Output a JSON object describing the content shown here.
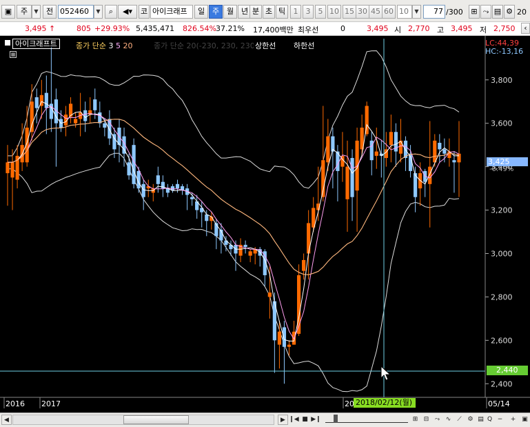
{
  "toolbar": {
    "market": "주",
    "prev": "전",
    "code": "052460",
    "kor": "코",
    "name": "아이크래프",
    "periods": [
      "일",
      "주",
      "월",
      "년"
    ],
    "sub": [
      "분",
      "초",
      "틱"
    ],
    "intervals": [
      "1",
      "3",
      "5",
      "10",
      "15",
      "30",
      "45",
      "60"
    ],
    "count_value": "10",
    "page_value": "77",
    "page_total": "/300",
    "right_edge": "20"
  },
  "quote": {
    "price": "3,495",
    "arrow": "↑",
    "change": "805",
    "change_pct": "+29.93%",
    "volume": "5,435,471",
    "volume_ratio": "826.54%",
    "turnover": "37.21%",
    "amount": "17,400백만",
    "grade": "최우선",
    "grade_value": "0",
    "ask": "3,495",
    "open_label": "시",
    "open": "2,770",
    "high_label": "고",
    "high": "3,495",
    "low_label": "저",
    "low": "2,750"
  },
  "legend": {
    "name": "아이크래프트",
    "ma": "종가 단순",
    "ma_periods": [
      "3",
      "5",
      "20"
    ],
    "env": "종가 단순 20(-230, 230, 230)",
    "upper": "상한선",
    "lower": "하한선"
  },
  "lc": "LC:44,39",
  "hc": "HC:-13,16",
  "price_badge": "3,425",
  "price_change": "-0.49%",
  "cursor_badge": "2,440",
  "cursor_date": "2018/02/12(월)",
  "colors": {
    "up": "#ff6a00",
    "down": "#8ec8ff",
    "cursor_badge": "#66cc33",
    "price_badge": "#87b8ff"
  },
  "chart_data": {
    "type": "candlestick",
    "y_ticks": [
      "3,800",
      "3,600",
      "3,400",
      "3,200",
      "3,000",
      "2,800",
      "2,600",
      "2,400"
    ],
    "x_labels": [
      "2016",
      "2017",
      "20",
      "05/14"
    ],
    "ylim": [
      2350,
      3990
    ],
    "candles": [
      [
        3370,
        3420,
        3220,
        3500
      ],
      [
        3350,
        3420,
        3200,
        3480
      ],
      [
        3340,
        3450,
        3300,
        3500
      ],
      [
        3420,
        3500,
        3380,
        3600
      ],
      [
        3420,
        3580,
        3400,
        3680
      ],
      [
        3560,
        3700,
        3520,
        3780
      ],
      [
        3720,
        3670,
        3600,
        3760
      ],
      [
        3680,
        3730,
        3620,
        3800
      ],
      [
        3740,
        3670,
        3550,
        3820
      ],
      [
        3690,
        3620,
        3560,
        3950
      ],
      [
        3710,
        3600,
        3400,
        3760
      ],
      [
        3620,
        3580,
        3560,
        3660
      ],
      [
        3590,
        3640,
        3540,
        3680
      ],
      [
        3630,
        3690,
        3600,
        3720
      ],
      [
        3600,
        3620,
        3580,
        3650
      ],
      [
        3620,
        3650,
        3540,
        3740
      ],
      [
        3660,
        3610,
        3560,
        3700
      ],
      [
        3640,
        3660,
        3600,
        3720
      ],
      [
        3710,
        3660,
        3620,
        3760
      ],
      [
        3650,
        3600,
        3580,
        3700
      ],
      [
        3600,
        3580,
        3540,
        3620
      ],
      [
        3620,
        3530,
        3500,
        3660
      ],
      [
        3550,
        3480,
        3440,
        3580
      ],
      [
        3580,
        3500,
        3420,
        3620
      ],
      [
        3540,
        3460,
        3400,
        3580
      ],
      [
        3420,
        3360,
        3340,
        3460
      ],
      [
        3500,
        3320,
        3300,
        3530
      ],
      [
        3380,
        3300,
        3280,
        3400
      ],
      [
        3320,
        3260,
        3200,
        3340
      ],
      [
        3300,
        3310,
        3260,
        3340
      ],
      [
        3280,
        3300,
        3240,
        3320
      ],
      [
        3360,
        3320,
        3280,
        3400
      ],
      [
        3330,
        3300,
        3260,
        3360
      ],
      [
        3300,
        3280,
        3260,
        3320
      ],
      [
        3310,
        3290,
        3280,
        3320
      ],
      [
        3320,
        3300,
        3280,
        3340
      ],
      [
        3310,
        3290,
        3270,
        3320
      ],
      [
        3300,
        3270,
        3200,
        3320
      ],
      [
        3260,
        3250,
        3220,
        3280
      ],
      [
        3240,
        3200,
        3160,
        3270
      ],
      [
        3210,
        3190,
        3120,
        3240
      ],
      [
        3180,
        3150,
        3080,
        3200
      ],
      [
        3150,
        3170,
        3110,
        3190
      ],
      [
        3140,
        3080,
        3020,
        3160
      ],
      [
        3110,
        3060,
        3000,
        3140
      ],
      [
        3060,
        3040,
        3010,
        3080
      ],
      [
        3040,
        3020,
        2990,
        3060
      ],
      [
        3040,
        3000,
        2920,
        3060
      ],
      [
        2990,
        3040,
        2960,
        3070
      ],
      [
        3040,
        3030,
        3000,
        3060
      ],
      [
        2990,
        3010,
        2960,
        3020
      ],
      [
        3000,
        3020,
        2950,
        3030
      ],
      [
        3020,
        2990,
        2940,
        3030
      ],
      [
        3010,
        2900,
        2850,
        3020
      ],
      [
        2800,
        2820,
        2700,
        2940
      ],
      [
        2780,
        2600,
        2450,
        2820
      ],
      [
        2580,
        2640,
        2470,
        2690
      ],
      [
        2660,
        2570,
        2400,
        2690
      ],
      [
        2570,
        2580,
        2530,
        2600
      ],
      [
        2580,
        2640,
        2580,
        2690
      ],
      [
        2630,
        2900,
        2620,
        2950
      ],
      [
        2920,
        2970,
        2880,
        3000
      ],
      [
        3000,
        3140,
        2880,
        3200
      ],
      [
        3120,
        3210,
        3100,
        3260
      ],
      [
        3200,
        3230,
        3150,
        3400
      ],
      [
        3260,
        3430,
        3240,
        3680
      ],
      [
        3420,
        3540,
        3380,
        3620
      ],
      [
        3540,
        3470,
        3300,
        3580
      ],
      [
        3470,
        3380,
        3240,
        3500
      ],
      [
        3400,
        3450,
        3330,
        3560
      ],
      [
        3250,
        3400,
        3100,
        3520
      ],
      [
        3440,
        3260,
        3150,
        3480
      ],
      [
        3290,
        3520,
        3100,
        3580
      ],
      [
        3480,
        3580,
        3450,
        3640
      ],
      [
        3550,
        3680,
        3540,
        3700
      ],
      [
        3520,
        3430,
        3360,
        3560
      ],
      [
        3450,
        3470,
        3390,
        3580
      ],
      [
        3460,
        3450,
        3350,
        3520
      ],
      [
        3440,
        3480,
        3400,
        3560
      ],
      [
        3500,
        3560,
        3420,
        3640
      ],
      [
        3560,
        3470,
        3400,
        3600
      ],
      [
        3460,
        3520,
        3420,
        3620
      ],
      [
        3520,
        3440,
        3380,
        3540
      ],
      [
        3460,
        3380,
        3350,
        3500
      ],
      [
        3370,
        3260,
        3190,
        3400
      ],
      [
        3300,
        3370,
        3220,
        3420
      ],
      [
        3380,
        3330,
        3260,
        3390
      ],
      [
        3320,
        3400,
        3120,
        3610
      ],
      [
        3420,
        3520,
        3400,
        3550
      ],
      [
        3510,
        3480,
        3420,
        3550
      ],
      [
        3480,
        3460,
        3420,
        3530
      ],
      [
        3440,
        3470,
        3400,
        3530
      ],
      [
        3430,
        3420,
        3280,
        3470
      ],
      [
        3420,
        3460,
        3260,
        3610
      ]
    ]
  },
  "bottom": {
    "zoom": "Q"
  }
}
